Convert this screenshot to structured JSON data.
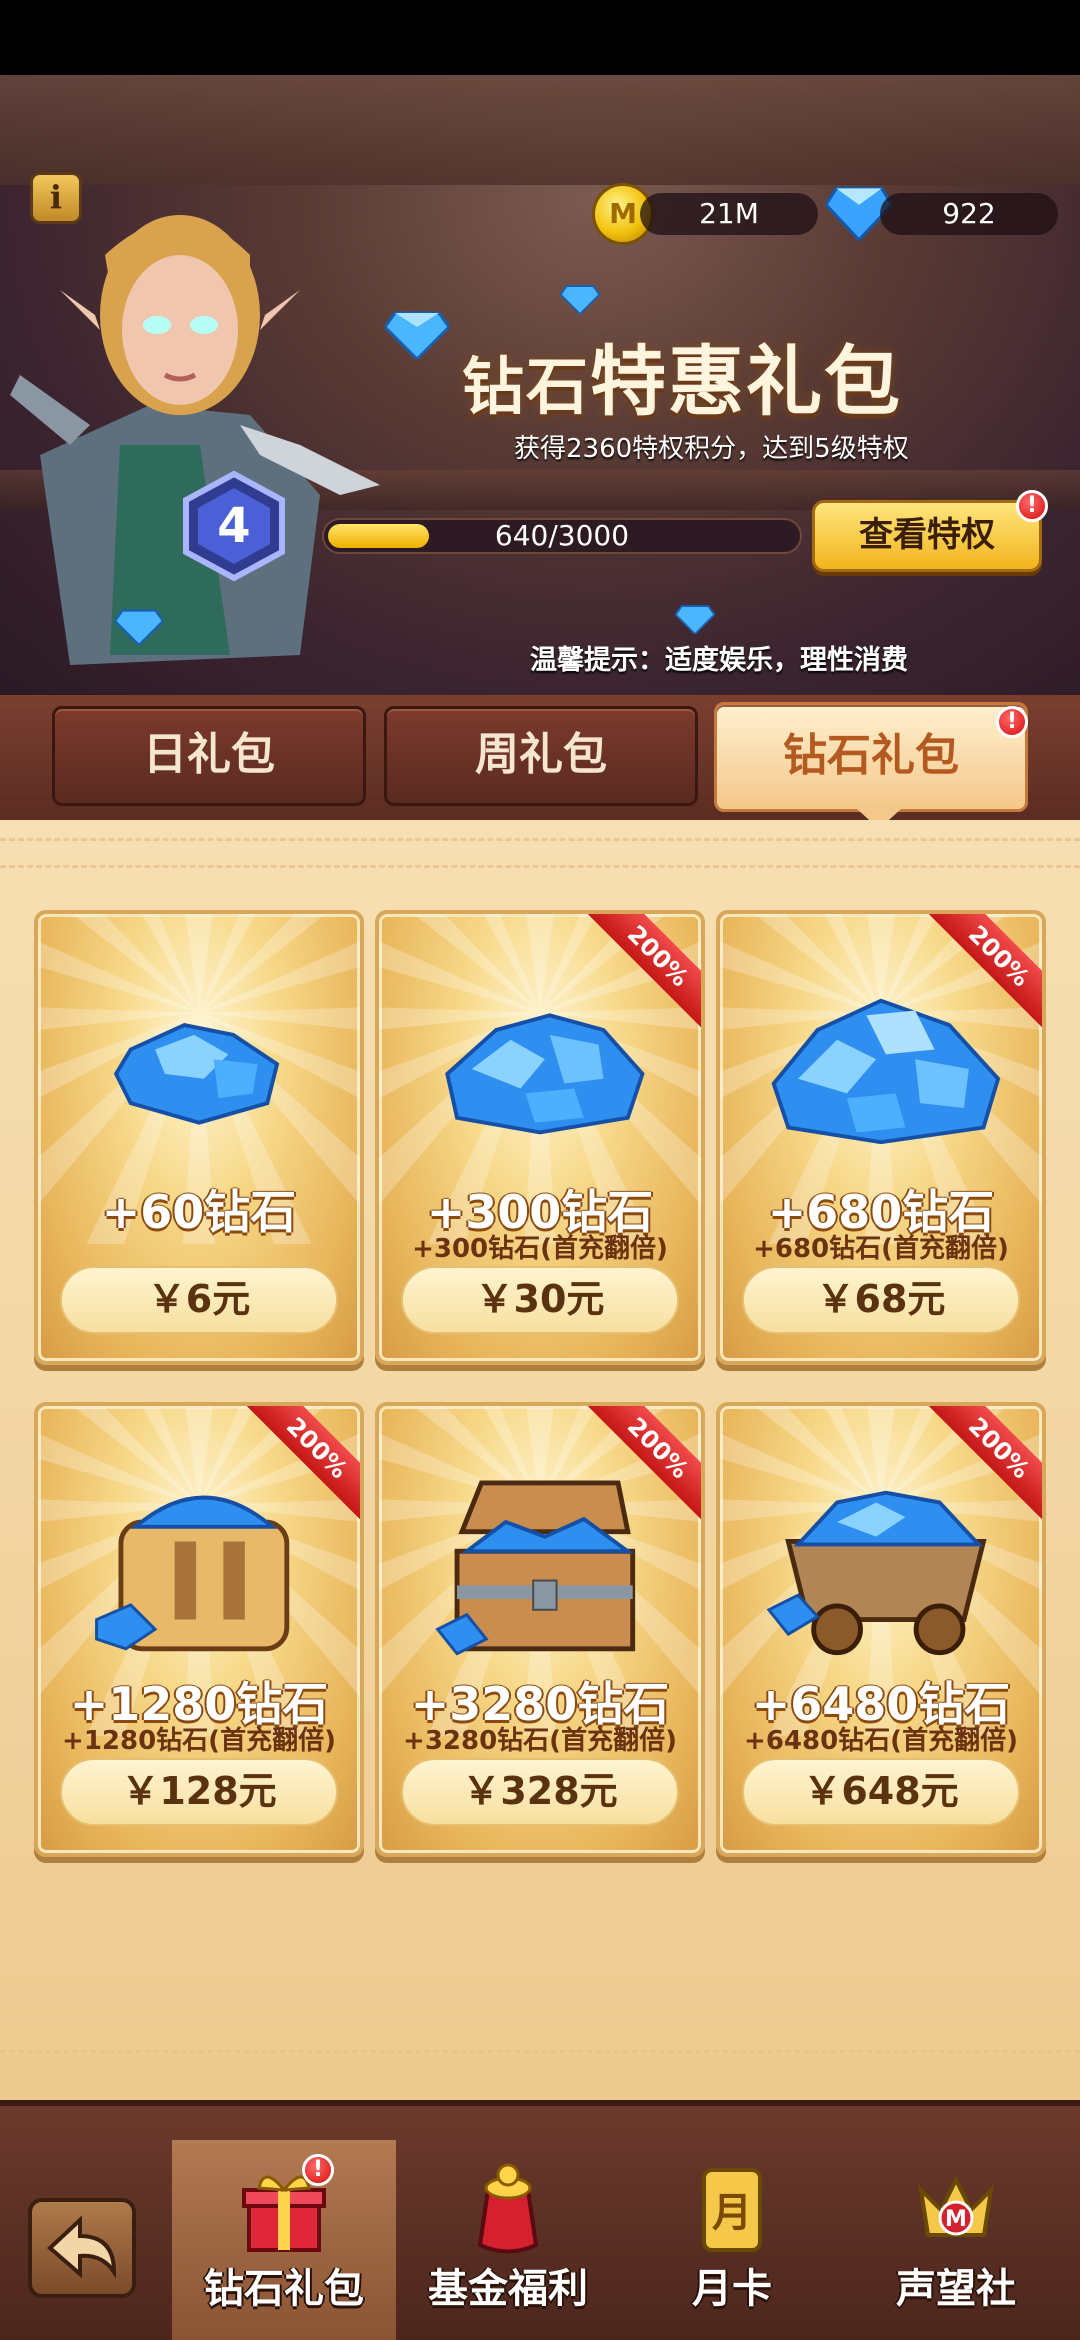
{
  "currency": {
    "coins": "21M",
    "gems": "922"
  },
  "header": {
    "title_part1": "钻石",
    "title_part2": "特惠礼包",
    "subtitle": "获得2360特权积分，达到5级特权",
    "level": "4",
    "progress_text": "640/3000",
    "progress_fraction": 0.213,
    "view_button": "查看特权",
    "hint": "温馨提示：适度娱乐，理性消费",
    "info_icon": "i"
  },
  "tabs": [
    {
      "label": "日礼包"
    },
    {
      "label": "周礼包"
    },
    {
      "label": "钻石礼包"
    }
  ],
  "alert_mark": "!",
  "packs": [
    {
      "amount": "+60钻石",
      "bonus": "",
      "price": "￥6元",
      "ribbon": "",
      "icon": "gem-pile-small-icon"
    },
    {
      "amount": "+300钻石",
      "bonus": "+300钻石(首充翻倍)",
      "price": "￥30元",
      "ribbon": "200%",
      "icon": "gem-pile-medium-icon"
    },
    {
      "amount": "+680钻石",
      "bonus": "+680钻石(首充翻倍)",
      "price": "￥68元",
      "ribbon": "200%",
      "icon": "gem-pile-large-icon"
    },
    {
      "amount": "+1280钻石",
      "bonus": "+1280钻石(首充翻倍)",
      "price": "￥128元",
      "ribbon": "200%",
      "icon": "gem-bag-icon"
    },
    {
      "amount": "+3280钻石",
      "bonus": "+3280钻石(首充翻倍)",
      "price": "￥328元",
      "ribbon": "200%",
      "icon": "gem-chest-icon"
    },
    {
      "amount": "+6480钻石",
      "bonus": "+6480钻石(首充翻倍)",
      "price": "￥648元",
      "ribbon": "200%",
      "icon": "gem-cart-icon"
    }
  ],
  "nav": [
    {
      "label": "钻石礼包",
      "icon": "gift-box-icon"
    },
    {
      "label": "基金福利",
      "icon": "money-bag-icon"
    },
    {
      "label": "月卡",
      "icon": "month-card-icon",
      "glyph": "月"
    },
    {
      "label": "声望社",
      "icon": "crown-emblem-icon",
      "glyph": "M"
    }
  ]
}
